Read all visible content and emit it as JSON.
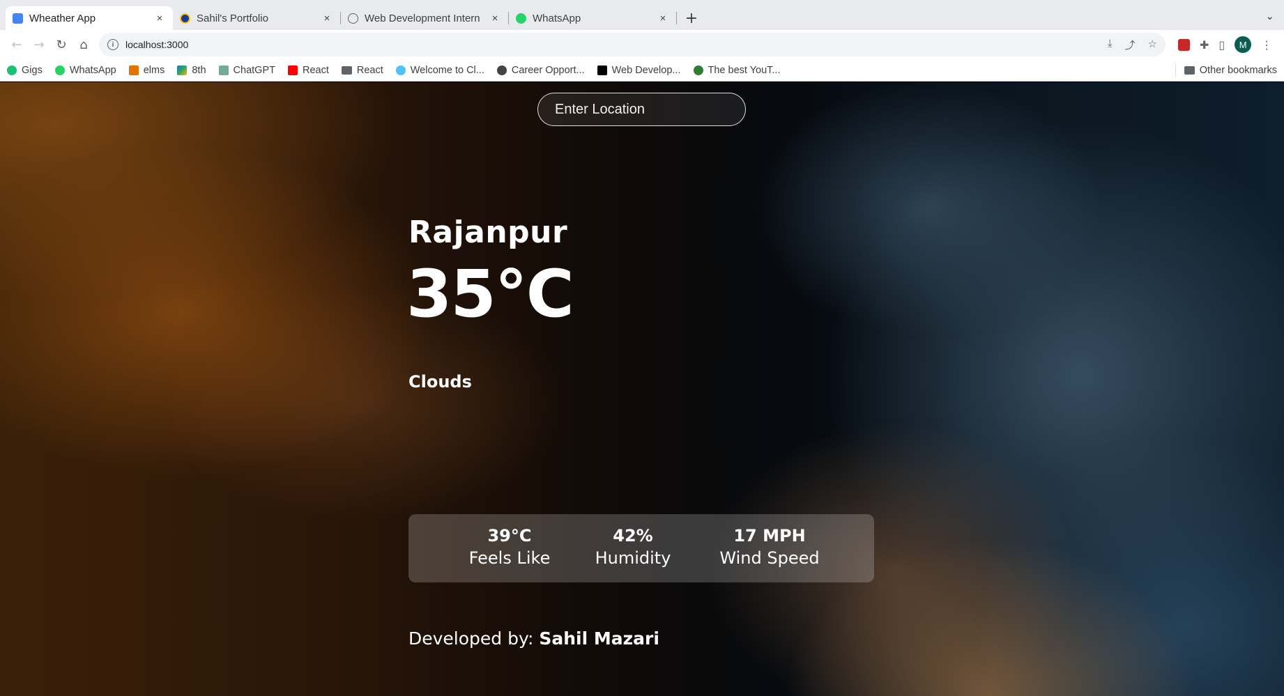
{
  "browser": {
    "tabs": [
      {
        "title": "Wheather App",
        "favicon_color": "#4285f4",
        "active": true
      },
      {
        "title": "Sahil's Portfolio",
        "favicon_color": "#1e3a8a",
        "active": false
      },
      {
        "title": "Web Development Intern",
        "favicon_color": "#5f6368",
        "active": false
      },
      {
        "title": "WhatsApp",
        "favicon_color": "#25d366",
        "active": false
      }
    ],
    "tab_close_glyph": "×",
    "new_tab_glyph": "+",
    "url": "localhost:3000",
    "avatar_initial": "M",
    "bookmarks": [
      {
        "label": "Gigs",
        "icon_color": "#1dbf73"
      },
      {
        "label": "WhatsApp",
        "icon_color": "#25d366"
      },
      {
        "label": "elms",
        "icon_color": "#e37400"
      },
      {
        "label": "8th",
        "icon_color": "#1a73e8"
      },
      {
        "label": "ChatGPT",
        "icon_color": "#74aa9c"
      },
      {
        "label": "React",
        "icon_color": "#ff0000"
      },
      {
        "label": "React",
        "icon_color": "#5f6368"
      },
      {
        "label": "Welcome to Cl...",
        "icon_color": "#4fc3f7"
      },
      {
        "label": "Career Opport...",
        "icon_color": "#444444"
      },
      {
        "label": "Web Develop...",
        "icon_color": "#000000"
      },
      {
        "label": "The best YouT...",
        "icon_color": "#2e7d32"
      }
    ],
    "other_bookmarks": "Other bookmarks"
  },
  "weather": {
    "search_placeholder": "Enter Location",
    "city": "Rajanpur",
    "temperature": "35°C",
    "description": "Clouds",
    "feels_like_value": "39°C",
    "feels_like_label": "Feels Like",
    "humidity_value": "42%",
    "humidity_label": "Humidity",
    "wind_value": "17 MPH",
    "wind_label": "Wind Speed",
    "credit_prefix": "Developed by:",
    "credit_name": "Sahil Mazari"
  }
}
